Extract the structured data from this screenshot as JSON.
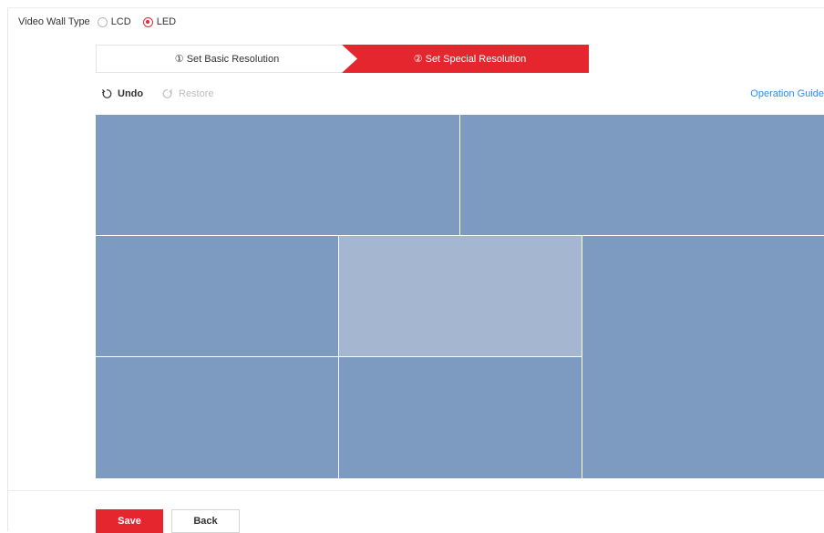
{
  "video_wall_type": {
    "label": "Video Wall Type",
    "options": [
      "LCD",
      "LED"
    ],
    "selected": "LED"
  },
  "steps": [
    {
      "label": "① Set Basic Resolution",
      "active": false
    },
    {
      "label": "② Set Special Resolution",
      "active": true
    }
  ],
  "toolbar": {
    "undo_label": "Undo",
    "restore_label": "Restore",
    "guide_label": "Operation Guide"
  },
  "wall": {
    "panel_count": 7,
    "panel_color": "#7d9bc0",
    "selected_panel_color": "#a4b6d0",
    "selected_panel": 4
  },
  "buttons": {
    "save_label": "Save",
    "back_label": "Back"
  },
  "colors": {
    "accent": "#e6262f",
    "link": "#2d8cf0"
  }
}
